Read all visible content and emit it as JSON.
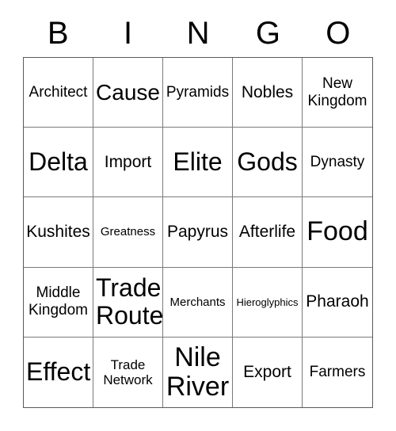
{
  "card": {
    "title": "BINGO",
    "columns": 5,
    "rows": 5,
    "background_color": "#ffffff",
    "text_color": "#000000",
    "grid_line_color": "#7a7a7a",
    "outer_border_color": "#5a5a5a"
  },
  "header": {
    "letters": [
      "B",
      "I",
      "N",
      "G",
      "O"
    ]
  },
  "grid": {
    "cells": [
      {
        "text": "Architect",
        "size": "m"
      },
      {
        "text": "Cause",
        "size": "xl"
      },
      {
        "text": "Pyramids",
        "size": "m"
      },
      {
        "text": "Nobles",
        "size": "ml"
      },
      {
        "text": "New\nKingdom",
        "size": "m"
      },
      {
        "text": "Delta",
        "size": "xxl"
      },
      {
        "text": "Import",
        "size": "ml"
      },
      {
        "text": "Elite",
        "size": "xxl"
      },
      {
        "text": "Gods",
        "size": "xxl"
      },
      {
        "text": "Dynasty",
        "size": "m"
      },
      {
        "text": "Kushites",
        "size": "ml"
      },
      {
        "text": "Greatness",
        "size": "s"
      },
      {
        "text": "Papyrus",
        "size": "ml"
      },
      {
        "text": "Afterlife",
        "size": "ml"
      },
      {
        "text": "Food",
        "size": "xxxl"
      },
      {
        "text": "Middle\nKingdom",
        "size": "m"
      },
      {
        "text": "Trade\nRoute",
        "size": "xxl"
      },
      {
        "text": "Merchants",
        "size": "s"
      },
      {
        "text": "Hieroglyphics",
        "size": "xs"
      },
      {
        "text": "Pharaoh",
        "size": "ml"
      },
      {
        "text": "Effect",
        "size": "xxl"
      },
      {
        "text": "Trade\nNetwork",
        "size": "sm"
      },
      {
        "text": "Nile\nRiver",
        "size": "xxxl"
      },
      {
        "text": "Export",
        "size": "ml"
      },
      {
        "text": "Farmers",
        "size": "m"
      }
    ]
  }
}
